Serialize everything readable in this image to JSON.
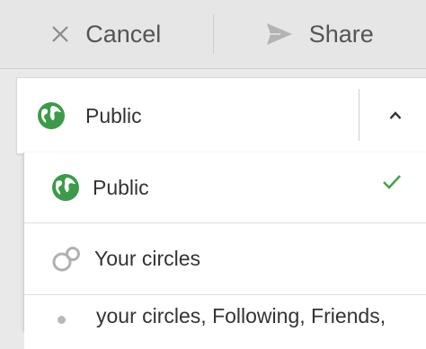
{
  "toolbar": {
    "cancel_label": "Cancel",
    "share_label": "Share"
  },
  "audience": {
    "selected_label": "Public",
    "options": [
      {
        "label": "Public",
        "icon": "globe-icon",
        "selected": true
      },
      {
        "label": "Your circles",
        "icon": "circles-icon",
        "selected": false
      },
      {
        "label": "your circles, Following, Friends,",
        "icon": "dot-icon",
        "selected": false
      }
    ]
  },
  "colors": {
    "globe_green": "#3e9a4a",
    "check_green": "#45a24f",
    "text": "#333333"
  }
}
